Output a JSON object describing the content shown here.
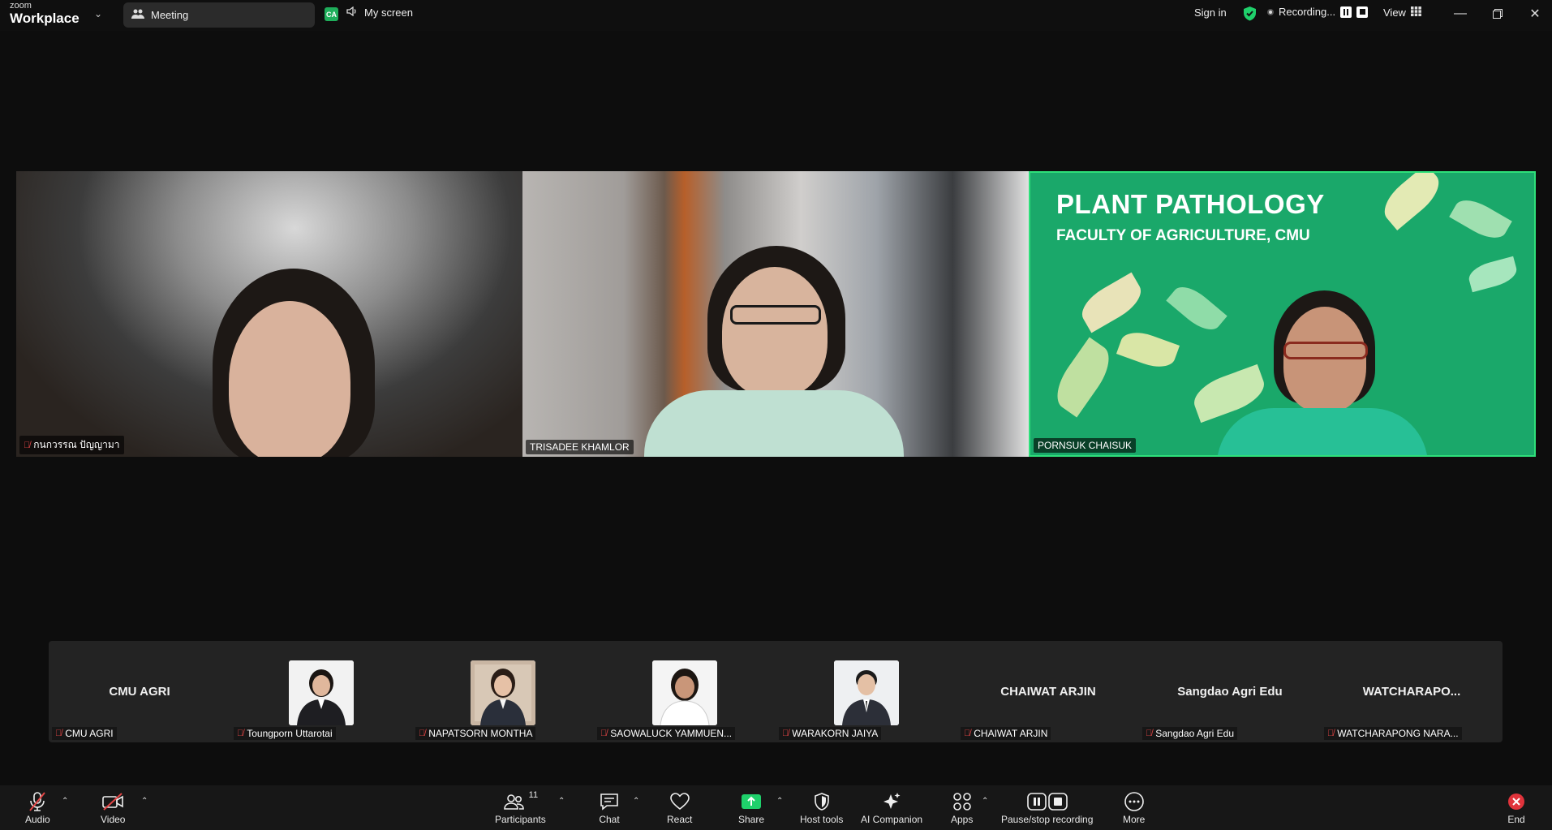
{
  "titlebar": {
    "brand_small": "zoom",
    "brand_big": "Workplace",
    "meeting_label": "Meeting",
    "ca_badge": "CA",
    "my_screen": "My screen",
    "sign_in": "Sign in",
    "recording_label": "Recording...",
    "view_label": "View"
  },
  "tiles": [
    {
      "name": "กนกวรรณ ปัญญามา",
      "muted": true
    },
    {
      "name": "TRISADEE KHAMLOR",
      "muted": false
    },
    {
      "name": "PORNSUK CHAISUK",
      "muted": false,
      "active_speaker": true
    }
  ],
  "background": {
    "title": "PLANT PATHOLOGY",
    "subtitle": "FACULTY OF AGRICULTURE, CMU"
  },
  "strip": [
    {
      "display": "CMU AGRI",
      "label": "CMU AGRI",
      "has_photo": false
    },
    {
      "display": "",
      "label": "Toungporn Uttarotai",
      "has_photo": true
    },
    {
      "display": "",
      "label": "NAPATSORN MONTHA",
      "has_photo": true
    },
    {
      "display": "",
      "label": "SAOWALUCK YAMMUEN...",
      "has_photo": true
    },
    {
      "display": "",
      "label": "WARAKORN JAIYA",
      "has_photo": true
    },
    {
      "display": "CHAIWAT ARJIN",
      "label": "CHAIWAT ARJIN",
      "has_photo": false
    },
    {
      "display": "Sangdao Agri Edu",
      "label": "Sangdao Agri Edu",
      "has_photo": false
    },
    {
      "display": "WATCHARAPO...",
      "label": "WATCHARAPONG NARA...",
      "has_photo": false
    }
  ],
  "toolbar": {
    "audio": "Audio",
    "video": "Video",
    "participants": "Participants",
    "participants_count": "11",
    "chat": "Chat",
    "react": "React",
    "share": "Share",
    "host_tools": "Host tools",
    "ai_companion": "AI Companion",
    "apps": "Apps",
    "pause_stop": "Pause/stop recording",
    "more": "More",
    "end": "End"
  },
  "colors": {
    "share_green": "#1fd06b",
    "end_red": "#e0333b",
    "active_border": "#2ee07a",
    "mute_red": "#e24545"
  }
}
